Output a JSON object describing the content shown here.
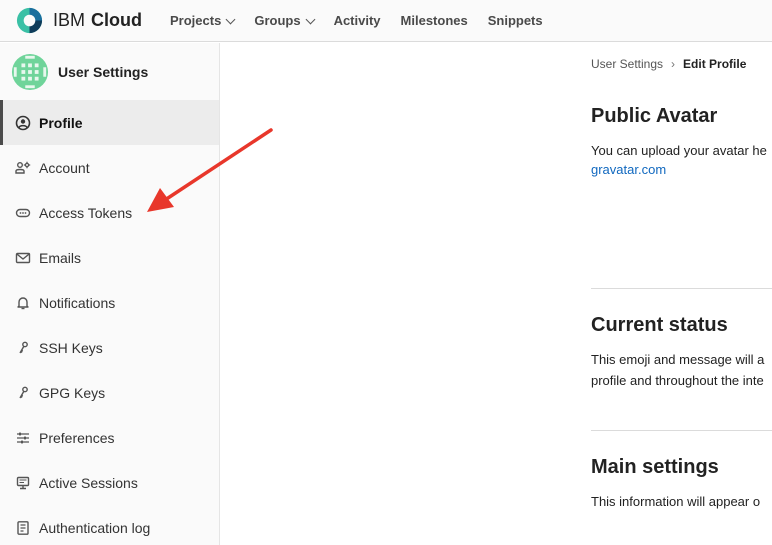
{
  "brand": {
    "word1": "IBM",
    "word2": "Cloud"
  },
  "nav": {
    "items": [
      {
        "label": "Projects",
        "dropdown": true
      },
      {
        "label": "Groups",
        "dropdown": true
      },
      {
        "label": "Activity",
        "dropdown": false
      },
      {
        "label": "Milestones",
        "dropdown": false
      },
      {
        "label": "Snippets",
        "dropdown": false
      }
    ]
  },
  "sidebar": {
    "title": "User Settings",
    "items": [
      {
        "label": "Profile",
        "icon": "profile-icon",
        "active": true
      },
      {
        "label": "Account",
        "icon": "account-icon"
      },
      {
        "label": "Access Tokens",
        "icon": "token-icon"
      },
      {
        "label": "Emails",
        "icon": "mail-icon"
      },
      {
        "label": "Notifications",
        "icon": "bell-icon"
      },
      {
        "label": "SSH Keys",
        "icon": "key-icon"
      },
      {
        "label": "GPG Keys",
        "icon": "key-icon"
      },
      {
        "label": "Preferences",
        "icon": "preferences-icon"
      },
      {
        "label": "Active Sessions",
        "icon": "monitor-icon"
      },
      {
        "label": "Authentication log",
        "icon": "log-icon"
      }
    ]
  },
  "breadcrumb": {
    "parent": "User Settings",
    "current": "Edit Profile"
  },
  "sections": {
    "avatar": {
      "title": "Public Avatar",
      "line1": "You can upload your avatar he",
      "link": "gravatar.com"
    },
    "status": {
      "title": "Current status",
      "line1": "This emoji and message will a",
      "line2": "profile and throughout the inte"
    },
    "main": {
      "title": "Main settings",
      "line1": "This information will appear o"
    }
  },
  "colors": {
    "accent_arrow": "#e8372b",
    "link": "#1068bf"
  }
}
